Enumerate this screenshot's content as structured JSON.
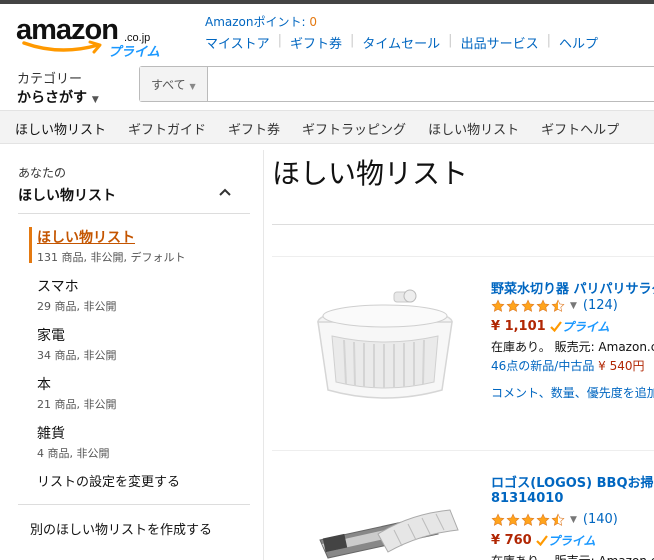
{
  "header": {
    "logo_text": "amazon",
    "logo_domain": ".co.jp",
    "logo_prime": "プライム",
    "points_label": "Amazonポイント: ",
    "points_value": "0",
    "nav": [
      "マイストア",
      "ギフト券",
      "タイムセール",
      "出品サービス",
      "ヘルプ"
    ],
    "category_line1": "カテゴリー",
    "category_line2": "からさがす",
    "search_category": "すべて"
  },
  "subnav": [
    "ほしい物リスト",
    "ギフトガイド",
    "ギフト券",
    "ギフトラッピング",
    "ほしい物リスト",
    "ギフトヘルプ"
  ],
  "sidebar": {
    "title_small": "あなたの",
    "title": "ほしい物リスト",
    "lists": [
      {
        "name": "ほしい物リスト",
        "meta": "131 商品, 非公開, デフォルト",
        "active": true
      },
      {
        "name": "スマホ",
        "meta": "29 商品, 非公開"
      },
      {
        "name": "家電",
        "meta": "34 商品, 非公開"
      },
      {
        "name": "本",
        "meta": "21 商品, 非公開"
      },
      {
        "name": "雑貨",
        "meta": "4 商品, 非公開"
      }
    ],
    "settings_link": "リストの設定を変更する",
    "create_link": "別のほしい物リストを作成する"
  },
  "main": {
    "title": "ほしい物リスト",
    "items": [
      {
        "title": "野菜水切り器 パリパリサラダ",
        "rating": 4.5,
        "review_count": "(124)",
        "price": "¥ 1,101",
        "prime": "プライム",
        "availability": "在庫あり。 販売元: Amazon.co",
        "offers_text": "46点の新品/中古品",
        "offers_price": "¥ 540円",
        "comment_link": "コメント、数量、優先度を追加"
      },
      {
        "title": "ロゴス(LOGOS) BBQお掃除",
        "title2": "81314010",
        "rating": 4.5,
        "review_count": "(140)",
        "price": "¥ 760",
        "prime": "プライム",
        "availability": "在庫あり。 販売元: Amazon.co"
      }
    ]
  },
  "colors": {
    "link": "#0066c0",
    "price": "#b12704",
    "accent": "#e47911",
    "prime": "#1a98ff",
    "star": "#ffa41c"
  }
}
